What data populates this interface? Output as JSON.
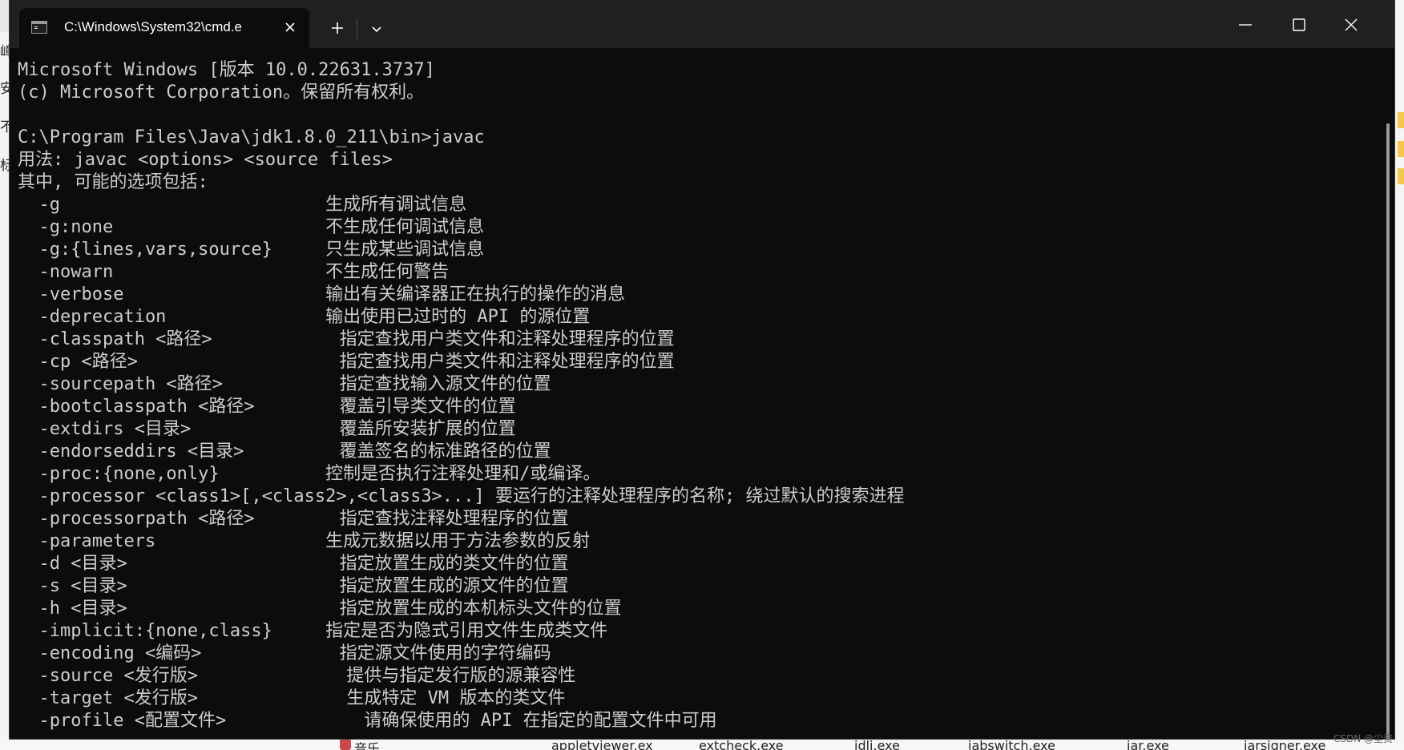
{
  "window": {
    "tab_title": "C:\\Windows\\System32\\cmd.e",
    "tab_close_glyph": "✕",
    "new_tab_glyph": "+"
  },
  "terminal_lines": [
    "Microsoft Windows [版本 10.0.22631.3737]",
    "(c) Microsoft Corporation。保留所有权利。",
    "",
    "C:\\Program Files\\Java\\jdk1.8.0_211\\bin>javac",
    "用法: javac <options> <source files>",
    "其中, 可能的选项包括:",
    "  -g                         生成所有调试信息",
    "  -g:none                    不生成任何调试信息",
    "  -g:{lines,vars,source}     只生成某些调试信息",
    "  -nowarn                    不生成任何警告",
    "  -verbose                   输出有关编译器正在执行的操作的消息",
    "  -deprecation               输出使用已过时的 API 的源位置",
    "  -classpath <路径>            指定查找用户类文件和注释处理程序的位置",
    "  -cp <路径>                   指定查找用户类文件和注释处理程序的位置",
    "  -sourcepath <路径>           指定查找输入源文件的位置",
    "  -bootclasspath <路径>        覆盖引导类文件的位置",
    "  -extdirs <目录>              覆盖所安装扩展的位置",
    "  -endorseddirs <目录>         覆盖签名的标准路径的位置",
    "  -proc:{none,only}          控制是否执行注释处理和/或编译。",
    "  -processor <class1>[,<class2>,<class3>...] 要运行的注释处理程序的名称; 绕过默认的搜索进程",
    "  -processorpath <路径>        指定查找注释处理程序的位置",
    "  -parameters                生成元数据以用于方法参数的反射",
    "  -d <目录>                    指定放置生成的类文件的位置",
    "  -s <目录>                    指定放置生成的源文件的位置",
    "  -h <目录>                    指定放置生成的本机标头文件的位置",
    "  -implicit:{none,class}     指定是否为隐式引用文件生成类文件",
    "  -encoding <编码>             指定源文件使用的字符编码",
    "  -source <发行版>              提供与指定发行版的源兼容性",
    "  -target <发行版>              生成特定 VM 版本的类文件",
    "  -profile <配置文件>             请确保使用的 API 在指定的配置文件中可用"
  ],
  "background": {
    "left_fragments": [
      "嶂",
      "安",
      "不",
      "标"
    ],
    "taskbar_items": [
      "音乐",
      "appletviewer.ex",
      "extcheck.exe",
      "idlj.exe",
      "jabswitch.exe",
      "jar.exe",
      "jarsigner.exe"
    ],
    "watermark": "CSDN @尘资"
  },
  "icons": {
    "tab": "terminal-icon",
    "dropdown": "chevron-down-icon",
    "minimize": "minimize-icon",
    "maximize": "maximize-icon",
    "close": "close-icon"
  }
}
